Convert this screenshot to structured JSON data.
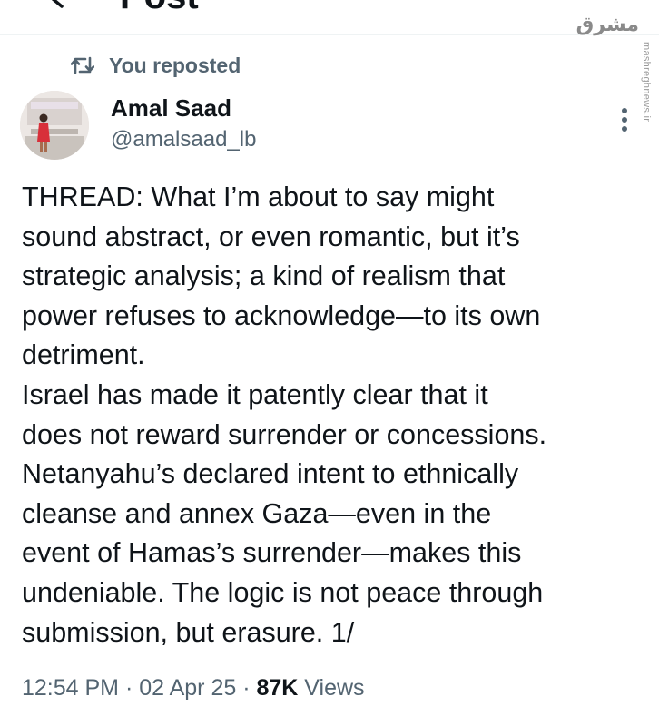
{
  "header": {
    "title": "Post"
  },
  "watermark": {
    "logo_text": "مشرق",
    "url": "mashreghnews.ir"
  },
  "repost": {
    "label": "You reposted"
  },
  "author": {
    "name": "Amal Saad",
    "handle": "@amalsaad_lb"
  },
  "tweet": {
    "lines": [
      "THREAD: What I’m about to say might",
      "sound abstract, or even romantic, but it’s",
      "strategic analysis; a kind of realism that",
      "power refuses to acknowledge—to its own",
      "detriment.",
      "Israel has made it patently clear that it",
      "does not reward surrender or concessions.",
      "Netanyahu’s declared intent to ethnically",
      "cleanse and annex Gaza—even in the",
      "event of Hamas’s surrender—makes this",
      "undeniable. The logic is not peace through",
      "submission, but erasure. 1/"
    ]
  },
  "meta": {
    "time": "12:54 PM",
    "separator": " · ",
    "date": "02 Apr 25",
    "views_count": "87K",
    "views_label": " Views"
  }
}
